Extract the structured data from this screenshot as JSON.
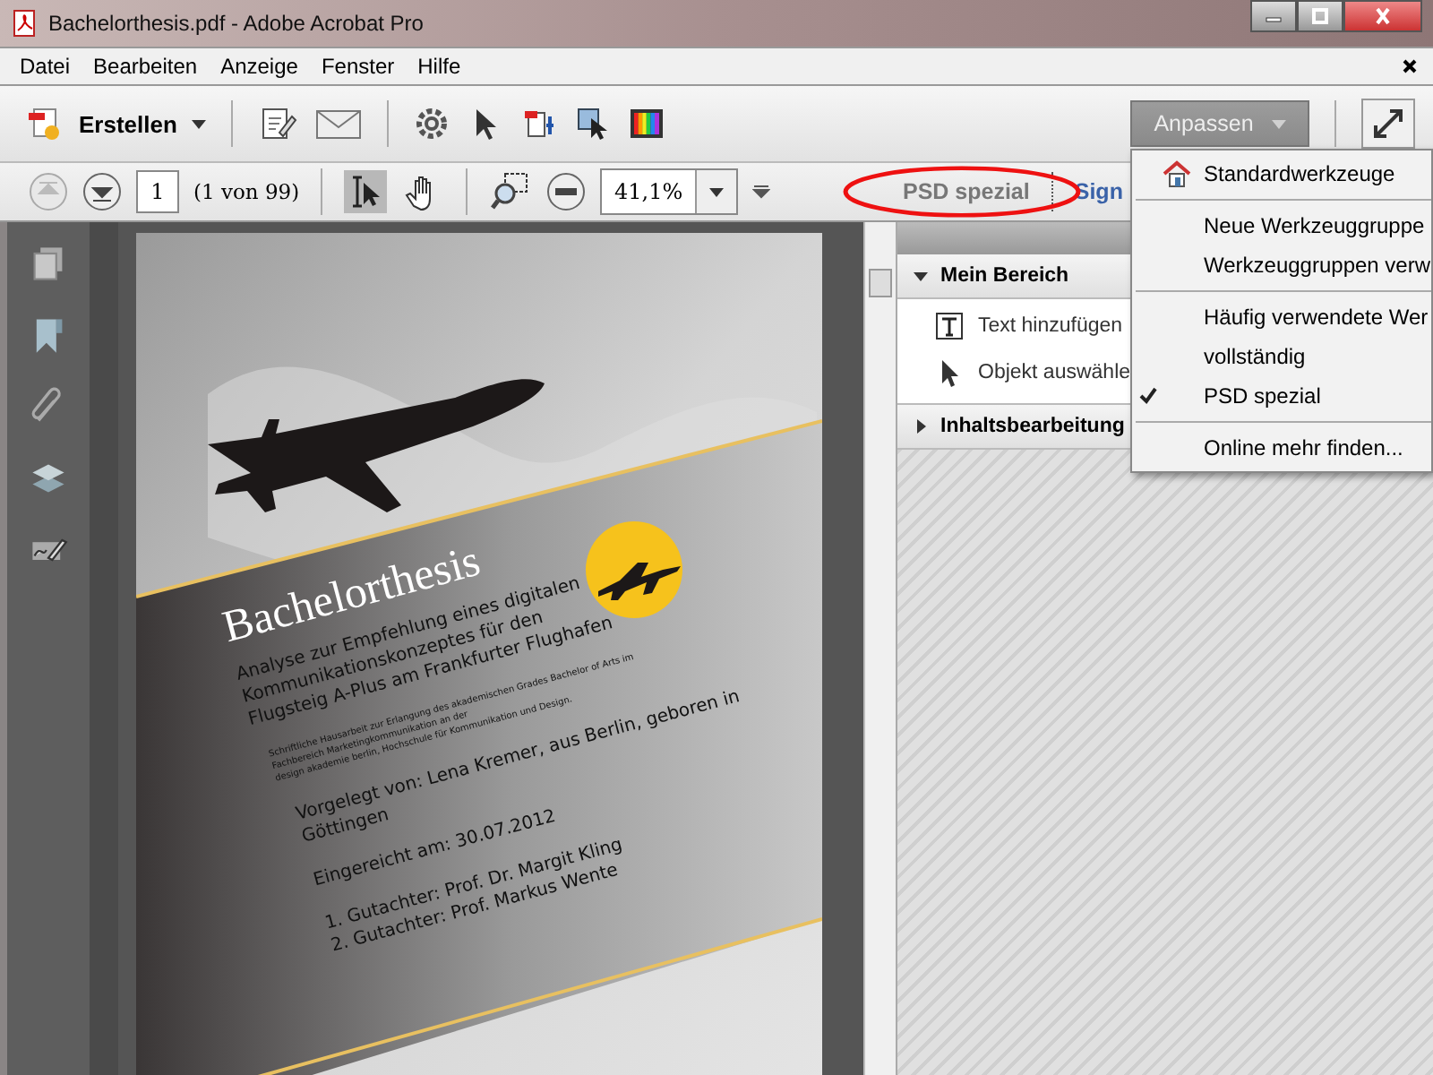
{
  "window": {
    "title": "Bachelorthesis.pdf - Adobe Acrobat Pro"
  },
  "menu_bar": [
    "Datei",
    "Bearbeiten",
    "Anzeige",
    "Fenster",
    "Hilfe"
  ],
  "toolbar": {
    "create_button": "Erstellen",
    "customize_button": "Anpassen"
  },
  "navigation": {
    "page_field": "1",
    "page_count": "(1 von 99)",
    "zoom_field": "41,1%"
  },
  "tool_sets": [
    {
      "label": "PSD spezial",
      "selected": true
    },
    {
      "label": "Sign",
      "selected": false
    }
  ],
  "dropdown_menu": [
    [
      {
        "label": "Standardwerkzeuge",
        "kind": "home",
        "checked": false
      }
    ],
    [
      {
        "label": "Neue Werkzeuggruppe",
        "kind": "plain",
        "checked": false
      },
      {
        "label": "Werkzeuggruppen verw",
        "kind": "plain",
        "checked": false
      }
    ],
    [
      {
        "label": "Häufig verwendete Wer",
        "kind": "plain",
        "checked": false
      },
      {
        "label": "vollständig",
        "kind": "plain",
        "checked": false
      },
      {
        "label": "PSD spezial",
        "kind": "plain",
        "checked": true
      }
    ],
    [
      {
        "label": "Online mehr finden...",
        "kind": "plain",
        "checked": false
      }
    ]
  ],
  "tools_panel": [
    {
      "title": "Mein Bereich",
      "expanded": true,
      "items": [
        {
          "label": "Text hinzufügen",
          "kind": "text"
        },
        {
          "label": "Objekt auswähle",
          "kind": "pointer"
        }
      ]
    },
    {
      "title": "Inhaltsbearbeitung",
      "expanded": false
    }
  ],
  "document_page": {
    "title": "Bachelorthesis",
    "subtitle": [
      "Analyse zur Empfehlung eines digitalen",
      "Kommunikationskonzeptes für den",
      "Flugsteig A-Plus am Frankfurter Flughafen"
    ],
    "description": [
      "Schriftliche Hausarbeit zur Erlangung des akademischen Grades Bachelor of Arts im",
      "Fachbereich Marketingkommunikation an der",
      "design akademie berlin, Hochschule für Kommunikation und Design."
    ],
    "author": [
      "Vorgelegt von: Lena Kremer, aus Berlin, geboren in",
      "Göttingen"
    ],
    "submitted": "Eingereicht am: 30.07.2012",
    "reviewers": [
      "1. Gutachter: Prof. Dr. Margit Kling",
      "2. Gutachter: Prof. Markus Wente"
    ]
  }
}
